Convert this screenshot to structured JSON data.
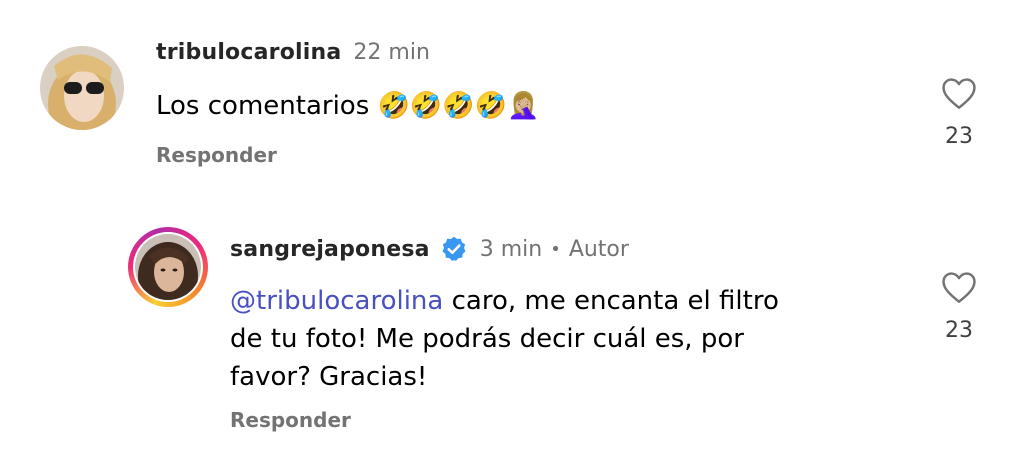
{
  "comments": [
    {
      "username": "tribulocarolina",
      "time": "22 min",
      "text": "Los comentarios",
      "emojis": "🤣🤣🤣🤣🤦🏼‍♀️",
      "reply_label": "Responder",
      "likes": "23",
      "story_ring": false
    },
    {
      "username": "sangrejaponesa",
      "verified": true,
      "time": "3 min",
      "separator": "•",
      "author_badge": "Autor",
      "mention": "@tribulocarolina",
      "text_line1": " caro, me encanta el filtro",
      "text_line2": "de tu foto! Me podrás decir cuál es, por",
      "text_line3": "favor? Gracias!",
      "reply_label": "Responder",
      "likes": "23",
      "story_ring": true
    }
  ],
  "icons": {
    "like": "heart-outline-icon",
    "verified": "verified-badge-icon",
    "mention": "threads-icon"
  },
  "colors": {
    "mention": "#4a4fc2",
    "verified": "#3897f0",
    "muted": "#737373"
  }
}
